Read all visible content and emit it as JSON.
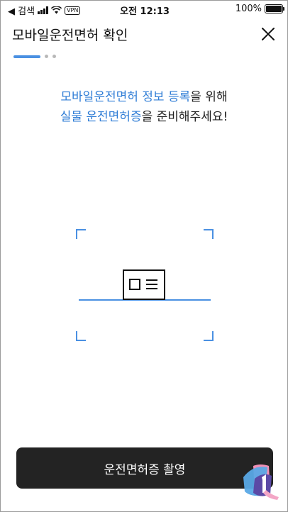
{
  "status_bar": {
    "back_app": "◀ 검색",
    "time": "오전 12:13",
    "vpn": "VPN",
    "battery": "100%"
  },
  "header": {
    "title": "모바일운전면허 확인"
  },
  "steps": {
    "total": 3,
    "current": 1
  },
  "instruction": {
    "line1_highlight": "모바일운전면허 정보 등록",
    "line1_rest": "을 위해",
    "line2_highlight": "실물 운전면허증",
    "line2_rest": "을 준비해주세요!"
  },
  "colors": {
    "accent": "#4a90e2",
    "button_bg": "#232323"
  },
  "capture_button": {
    "label": "운전면허증 촬영"
  }
}
